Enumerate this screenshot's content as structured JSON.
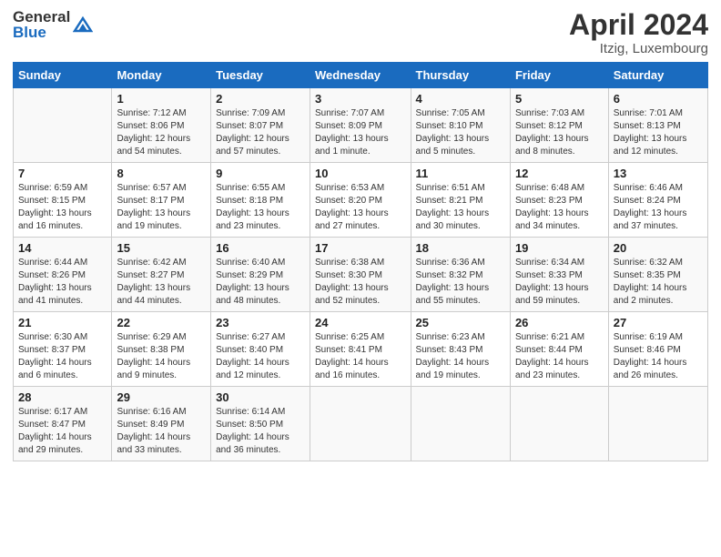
{
  "header": {
    "logo_line1": "General",
    "logo_line2": "Blue",
    "month_title": "April 2024",
    "location": "Itzig, Luxembourg"
  },
  "days_of_week": [
    "Sunday",
    "Monday",
    "Tuesday",
    "Wednesday",
    "Thursday",
    "Friday",
    "Saturday"
  ],
  "weeks": [
    [
      {
        "num": "",
        "info": ""
      },
      {
        "num": "1",
        "info": "Sunrise: 7:12 AM\nSunset: 8:06 PM\nDaylight: 12 hours\nand 54 minutes."
      },
      {
        "num": "2",
        "info": "Sunrise: 7:09 AM\nSunset: 8:07 PM\nDaylight: 12 hours\nand 57 minutes."
      },
      {
        "num": "3",
        "info": "Sunrise: 7:07 AM\nSunset: 8:09 PM\nDaylight: 13 hours\nand 1 minute."
      },
      {
        "num": "4",
        "info": "Sunrise: 7:05 AM\nSunset: 8:10 PM\nDaylight: 13 hours\nand 5 minutes."
      },
      {
        "num": "5",
        "info": "Sunrise: 7:03 AM\nSunset: 8:12 PM\nDaylight: 13 hours\nand 8 minutes."
      },
      {
        "num": "6",
        "info": "Sunrise: 7:01 AM\nSunset: 8:13 PM\nDaylight: 13 hours\nand 12 minutes."
      }
    ],
    [
      {
        "num": "7",
        "info": "Sunrise: 6:59 AM\nSunset: 8:15 PM\nDaylight: 13 hours\nand 16 minutes."
      },
      {
        "num": "8",
        "info": "Sunrise: 6:57 AM\nSunset: 8:17 PM\nDaylight: 13 hours\nand 19 minutes."
      },
      {
        "num": "9",
        "info": "Sunrise: 6:55 AM\nSunset: 8:18 PM\nDaylight: 13 hours\nand 23 minutes."
      },
      {
        "num": "10",
        "info": "Sunrise: 6:53 AM\nSunset: 8:20 PM\nDaylight: 13 hours\nand 27 minutes."
      },
      {
        "num": "11",
        "info": "Sunrise: 6:51 AM\nSunset: 8:21 PM\nDaylight: 13 hours\nand 30 minutes."
      },
      {
        "num": "12",
        "info": "Sunrise: 6:48 AM\nSunset: 8:23 PM\nDaylight: 13 hours\nand 34 minutes."
      },
      {
        "num": "13",
        "info": "Sunrise: 6:46 AM\nSunset: 8:24 PM\nDaylight: 13 hours\nand 37 minutes."
      }
    ],
    [
      {
        "num": "14",
        "info": "Sunrise: 6:44 AM\nSunset: 8:26 PM\nDaylight: 13 hours\nand 41 minutes."
      },
      {
        "num": "15",
        "info": "Sunrise: 6:42 AM\nSunset: 8:27 PM\nDaylight: 13 hours\nand 44 minutes."
      },
      {
        "num": "16",
        "info": "Sunrise: 6:40 AM\nSunset: 8:29 PM\nDaylight: 13 hours\nand 48 minutes."
      },
      {
        "num": "17",
        "info": "Sunrise: 6:38 AM\nSunset: 8:30 PM\nDaylight: 13 hours\nand 52 minutes."
      },
      {
        "num": "18",
        "info": "Sunrise: 6:36 AM\nSunset: 8:32 PM\nDaylight: 13 hours\nand 55 minutes."
      },
      {
        "num": "19",
        "info": "Sunrise: 6:34 AM\nSunset: 8:33 PM\nDaylight: 13 hours\nand 59 minutes."
      },
      {
        "num": "20",
        "info": "Sunrise: 6:32 AM\nSunset: 8:35 PM\nDaylight: 14 hours\nand 2 minutes."
      }
    ],
    [
      {
        "num": "21",
        "info": "Sunrise: 6:30 AM\nSunset: 8:37 PM\nDaylight: 14 hours\nand 6 minutes."
      },
      {
        "num": "22",
        "info": "Sunrise: 6:29 AM\nSunset: 8:38 PM\nDaylight: 14 hours\nand 9 minutes."
      },
      {
        "num": "23",
        "info": "Sunrise: 6:27 AM\nSunset: 8:40 PM\nDaylight: 14 hours\nand 12 minutes."
      },
      {
        "num": "24",
        "info": "Sunrise: 6:25 AM\nSunset: 8:41 PM\nDaylight: 14 hours\nand 16 minutes."
      },
      {
        "num": "25",
        "info": "Sunrise: 6:23 AM\nSunset: 8:43 PM\nDaylight: 14 hours\nand 19 minutes."
      },
      {
        "num": "26",
        "info": "Sunrise: 6:21 AM\nSunset: 8:44 PM\nDaylight: 14 hours\nand 23 minutes."
      },
      {
        "num": "27",
        "info": "Sunrise: 6:19 AM\nSunset: 8:46 PM\nDaylight: 14 hours\nand 26 minutes."
      }
    ],
    [
      {
        "num": "28",
        "info": "Sunrise: 6:17 AM\nSunset: 8:47 PM\nDaylight: 14 hours\nand 29 minutes."
      },
      {
        "num": "29",
        "info": "Sunrise: 6:16 AM\nSunset: 8:49 PM\nDaylight: 14 hours\nand 33 minutes."
      },
      {
        "num": "30",
        "info": "Sunrise: 6:14 AM\nSunset: 8:50 PM\nDaylight: 14 hours\nand 36 minutes."
      },
      {
        "num": "",
        "info": ""
      },
      {
        "num": "",
        "info": ""
      },
      {
        "num": "",
        "info": ""
      },
      {
        "num": "",
        "info": ""
      }
    ]
  ]
}
